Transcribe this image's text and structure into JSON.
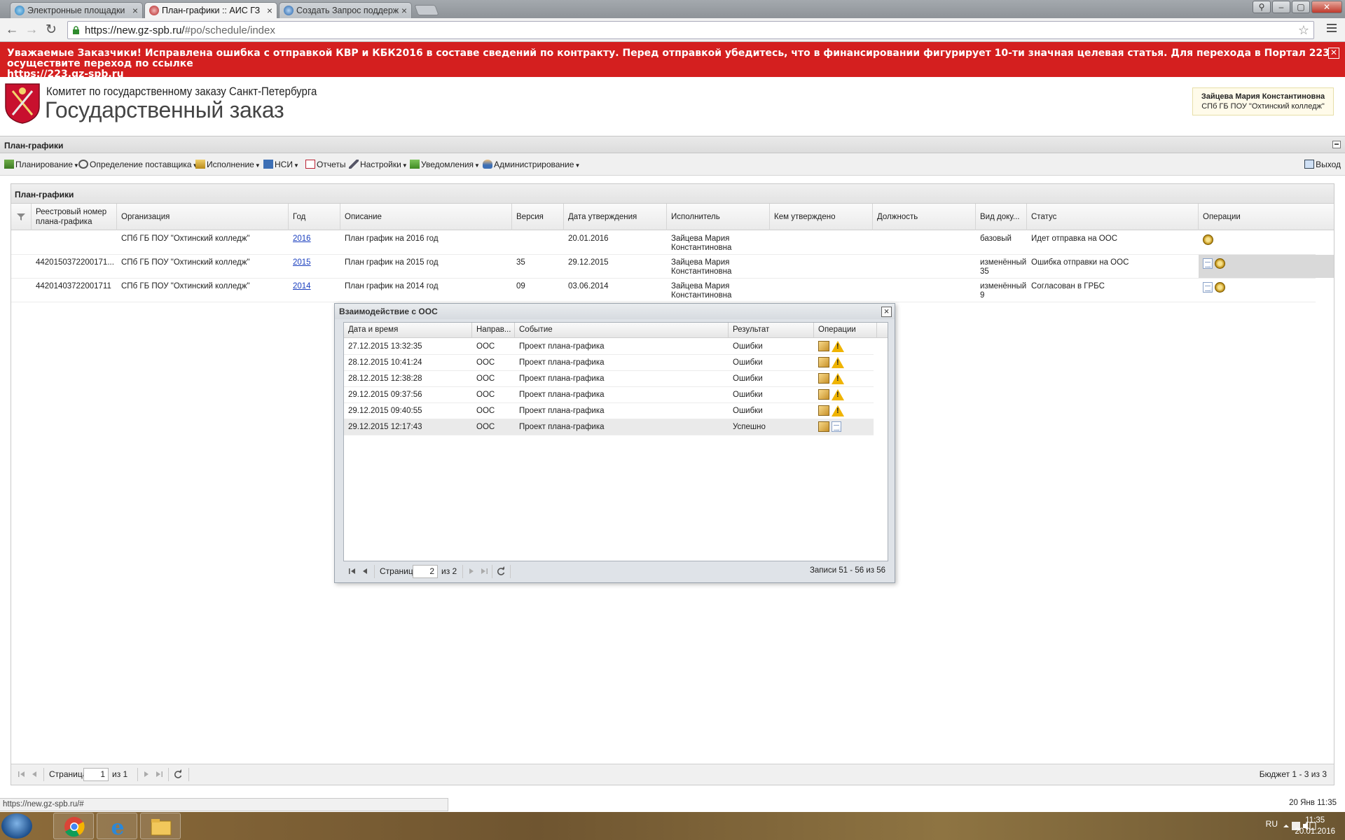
{
  "browser": {
    "tabs": [
      {
        "title": "Электронные площадки"
      },
      {
        "title": "План-графики :: АИС ГЗ"
      },
      {
        "title": "Создать Запрос поддерж"
      }
    ],
    "url_host": "https://new.gz-spb.ru/",
    "url_path": "#po/schedule/index"
  },
  "notice": {
    "text": "Уважаемые Заказчики! Исправлена ошибка с отправкой КВР и КБК2016 в составе сведений по контракту. Перед отправкой убедитесь, что в финансировании фигурирует 10-ти значная целевая статья. Для перехода в Портал 223 осуществите переход по ссылке",
    "link": "https://223.gz-spb.ru"
  },
  "header": {
    "org_line1": "Комитет по государственному заказу Санкт-Петербурга",
    "org_line2": "Государственный заказ",
    "user_name": "Зайцева Мария Константиновна",
    "user_org": "СПб ГБ ПОУ \"Охтинский колледж\""
  },
  "panel_title": "План-графики",
  "menu": {
    "items": [
      "Планирование",
      "Определение поставщика",
      "Исполнение",
      "НСИ",
      "Отчеты",
      "Настройки",
      "Уведомления",
      "Администрирование"
    ],
    "exit": "Выход"
  },
  "grid": {
    "title": "План-графики",
    "columns": [
      "Реестровый номер плана-графика",
      "Организация",
      "Год",
      "Описание",
      "Версия",
      "Дата утверждения",
      "Исполнитель",
      "Кем утверждено",
      "Должность",
      "Вид доку...",
      "Статус",
      "Операции"
    ],
    "rows": [
      {
        "reg": "",
        "org": "СПб ГБ ПОУ \"Охтинский колледж\"",
        "year": "2016",
        "desc": "План график на 2016 год",
        "ver": "",
        "date": "20.01.2016",
        "exec": "Зайцева Мария Константиновна",
        "kind": "базовый",
        "status": "Идет отправка на ООС"
      },
      {
        "reg": "4420150372200171...",
        "org": "СПб ГБ ПОУ \"Охтинский колледж\"",
        "year": "2015",
        "desc": "План график на 2015 год",
        "ver": "35",
        "date": "29.12.2015",
        "exec": "Зайцева Мария Константиновна",
        "kind": "изменённый 35",
        "status": "Ошибка отправки на ООС"
      },
      {
        "reg": "44201403722001711",
        "org": "СПб ГБ ПОУ \"Охтинский колледж\"",
        "year": "2014",
        "desc": "План график на 2014 год",
        "ver": "09",
        "date": "03.06.2014",
        "exec": "Зайцева Мария Константиновна",
        "kind": "изменённый 9",
        "status": "Согласован в ГРБС"
      }
    ],
    "pager": {
      "page_label": "Страница",
      "page": "1",
      "of": "из 1",
      "summary": "Бюджет 1 - 3 из 3"
    }
  },
  "dialog": {
    "title": "Взаимодействие с ООС",
    "columns": [
      "Дата и время",
      "Направ...",
      "Событие",
      "Результат",
      "Операции"
    ],
    "rows": [
      {
        "dt": "27.12.2015 13:32:35",
        "dir": "ООС",
        "event": "Проект плана-графика",
        "result": "Ошибки"
      },
      {
        "dt": "28.12.2015 10:41:24",
        "dir": "ООС",
        "event": "Проект плана-графика",
        "result": "Ошибки"
      },
      {
        "dt": "28.12.2015 12:38:28",
        "dir": "ООС",
        "event": "Проект плана-графика",
        "result": "Ошибки"
      },
      {
        "dt": "29.12.2015 09:37:56",
        "dir": "ООС",
        "event": "Проект плана-графика",
        "result": "Ошибки"
      },
      {
        "dt": "29.12.2015 09:40:55",
        "dir": "ООС",
        "event": "Проект плана-графика",
        "result": "Ошибки"
      },
      {
        "dt": "29.12.2015 12:17:43",
        "dir": "ООС",
        "event": "Проект плана-графика",
        "result": "Успешно"
      }
    ],
    "pager": {
      "page_label": "Страница",
      "page": "2",
      "of": "из 2",
      "summary": "Записи 51 - 56 из 56"
    }
  },
  "status_url": "https://new.gz-spb.ru/#",
  "status_datetime": "20 Янв 11:35",
  "taskbar": {
    "lang": "RU",
    "time": "11:35",
    "date": "20.01.2016"
  },
  "colors": {
    "notice_bg": "#d41f1f",
    "link": "#1a3fbf",
    "accent": "#1d4f8c"
  },
  "icons": [
    "chrome-icon",
    "ie-icon",
    "explorer-icon",
    "warning-icon",
    "package-icon",
    "document-icon",
    "eagle-emblem-icon"
  ]
}
